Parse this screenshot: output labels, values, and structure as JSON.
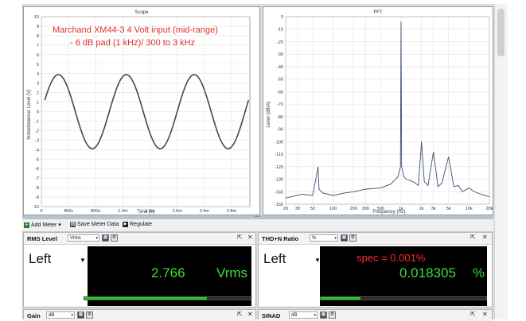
{
  "scope": {
    "title": "Scope",
    "annotation_line1": "Marchand XM44-3 4 Volt input (mid-range)",
    "annotation_line2": "- 6 dB pad (1 kHz)/ 300 to 3 kHz",
    "annotation_color": "#e0302a",
    "ylabel": "Instantaneous Level (V)",
    "xlabel": "Time (s)",
    "yticks": [
      "10",
      "9",
      "8",
      "7",
      "6",
      "5",
      "4",
      "3",
      "2",
      "1",
      "0",
      "-1",
      "-2",
      "-3",
      "-4",
      "-5",
      "-6",
      "-7",
      "-8",
      "-9",
      "-10"
    ],
    "xticks": [
      "0",
      "400u",
      "800u",
      "1.2m",
      "1.6m",
      "2.0m",
      "2.4m",
      "2.8m"
    ]
  },
  "fft": {
    "title": "FFT",
    "ylabel": "Level (dBrA)",
    "xlabel": "Frequency (Hz)",
    "yticks": [
      "0",
      "-10",
      "-20",
      "-30",
      "-40",
      "-50",
      "-60",
      "-70",
      "-80",
      "-90",
      "-100",
      "-110",
      "-120",
      "-130",
      "-140",
      "-150"
    ],
    "xticks": [
      "20",
      "30",
      "50",
      "100",
      "200",
      "300",
      "500",
      "1k",
      "2k",
      "3k",
      "5k",
      "10k",
      "20k"
    ]
  },
  "chart_data": [
    {
      "type": "line",
      "title": "Scope",
      "xlabel": "Time (s)",
      "ylabel": "Instantaneous Level (V)",
      "xlim": [
        0,
        0.00307
      ],
      "ylim": [
        -10,
        10
      ],
      "grid": true,
      "series": [
        {
          "color": "#3b4a5e",
          "amplitude": 3.9,
          "frequency_hz": 1000,
          "phase_rad": 0,
          "x_start": 5e-05,
          "x_end": 0.00305
        }
      ]
    },
    {
      "type": "line",
      "title": "FFT",
      "xlabel": "Frequency (Hz)",
      "ylabel": "Level (dBrA)",
      "x_scale": "log",
      "xlim": [
        20,
        20000
      ],
      "ylim": [
        -150,
        0
      ],
      "grid": true,
      "series": [
        {
          "color": "#3b4f73",
          "x": [
            20,
            35,
            50,
            60,
            62,
            70,
            100,
            150,
            200,
            300,
            500,
            700,
            800,
            900,
            980,
            1000,
            1020,
            1100,
            1200,
            1500,
            1800,
            2000,
            2200,
            2500,
            3000,
            3500,
            4000,
            5000,
            6000,
            7000,
            8000,
            10000,
            12000,
            15000,
            20000
          ],
          "y": [
            -145,
            -142,
            -143,
            -120,
            -138,
            -141,
            -143,
            -141,
            -140,
            -138,
            -137,
            -134,
            -131,
            -128,
            -120,
            -4,
            -120,
            -128,
            -130,
            -132,
            -135,
            -100,
            -132,
            -135,
            -108,
            -136,
            -133,
            -112,
            -136,
            -135,
            -140,
            -137,
            -140,
            -142,
            -144
          ]
        }
      ]
    }
  ],
  "splitter": {
    "grip": "• • •"
  },
  "toolbar": {
    "add_meter": "Add Meter",
    "add_meter_dd": "▾",
    "save_meter_data": "Save Meter Data",
    "regulate": "Regulate"
  },
  "meters": {
    "rms": {
      "name": "RMS Level",
      "unit_select": "Vrms",
      "channel": "Left",
      "value": "2.766",
      "unit": "Vrms",
      "bar_fraction": 0.74
    },
    "thdn": {
      "name": "THD+N Ratio",
      "unit_select": "%",
      "channel": "Left",
      "spec": "spec = 0.001%",
      "value": "0.018305",
      "unit": "%",
      "bar_fraction": 0.24
    },
    "gain": {
      "name": "Gain",
      "unit_select": "dB"
    },
    "sinad": {
      "name": "SINAD",
      "unit_select": "dB"
    }
  },
  "glyphs": {
    "dropdown": "▾",
    "channel_dd": "▼",
    "pop_out": "⇱",
    "close": "✕",
    "settings": "⚙",
    "graph": "▦",
    "add": "+",
    "save": "▤",
    "play": "▶"
  },
  "colors": {
    "display_bg": "#000000",
    "meter_value": "#3cdc3c",
    "spec_text": "#ff2a2a",
    "bar_fill": "#1ecf1e"
  }
}
